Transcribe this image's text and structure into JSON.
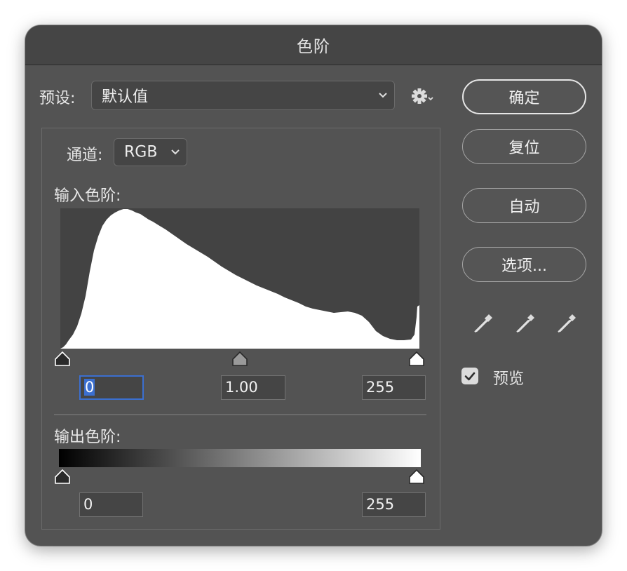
{
  "window": {
    "title": "色阶"
  },
  "preset": {
    "label": "预设:",
    "value": "默认值"
  },
  "channel": {
    "label": "通道:",
    "value": "RGB"
  },
  "input_levels": {
    "label": "输入色阶:",
    "black": "0",
    "gamma": "1.00",
    "white": "255"
  },
  "output_levels": {
    "label": "输出色阶:",
    "black": "0",
    "white": "255"
  },
  "buttons": {
    "ok": "确定",
    "reset": "复位",
    "auto": "自动",
    "options": "选项..."
  },
  "preview": {
    "label": "预览",
    "checked": true
  },
  "icons": {
    "gear": "gear-icon",
    "chevron": "chevron-down-icon",
    "eyedroppers": [
      "black-point-eyedropper-icon",
      "gray-point-eyedropper-icon",
      "white-point-eyedropper-icon"
    ]
  },
  "colors": {
    "panel": "#535353",
    "field": "#454545",
    "focus": "#3b6fd0"
  }
}
